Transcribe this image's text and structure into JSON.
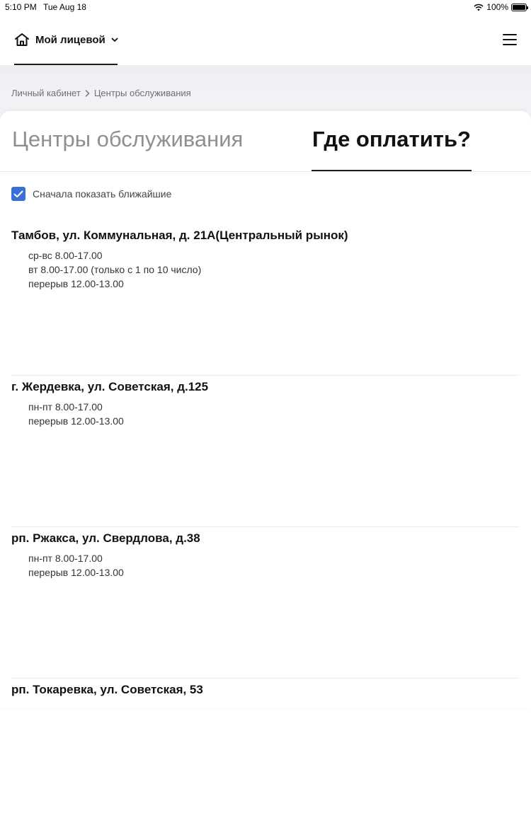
{
  "status_bar": {
    "time": "5:10 PM",
    "date": "Tue Aug 18",
    "battery": "100%"
  },
  "header": {
    "account_label": "Мой лицевой",
    "home_icon": "home-icon",
    "menu_icon": "hamburger-menu-icon"
  },
  "breadcrumb": {
    "items": [
      "Личный кабинет",
      "Центры обслуживания"
    ]
  },
  "tabs": [
    {
      "label": "Центры обслуживания",
      "active": false
    },
    {
      "label": "Где оплатить?",
      "active": true
    }
  ],
  "nearest": {
    "label": "Сначала показать ближайшие",
    "checked": true
  },
  "locations": [
    {
      "address": "Тамбов, ул. Коммунальная, д. 21А(Центральный рынок)",
      "hours": [
        "ср-вс 8.00-17.00",
        "вт 8.00-17.00 (только с 1 по 10 число)",
        "перерыв 12.00-13.00"
      ]
    },
    {
      "address": "г. Жердевка, ул. Советская, д.125",
      "hours": [
        "пн-пт 8.00-17.00",
        "перерыв 12.00-13.00"
      ]
    },
    {
      "address": "рп. Ржакса, ул. Свердлова, д.38",
      "hours": [
        "пн-пт 8.00-17.00",
        "перерыв 12.00-13.00"
      ]
    },
    {
      "address": "рп. Токаревка, ул. Советская, 53",
      "hours": []
    }
  ],
  "colors": {
    "accent": "#3c6fd6",
    "text": "#111111",
    "muted": "#8e8e93"
  }
}
